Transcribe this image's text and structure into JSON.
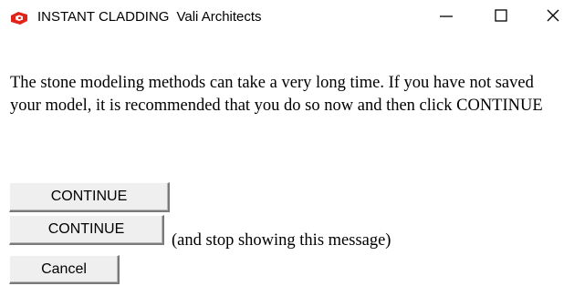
{
  "window": {
    "title": "INSTANT CLADDING",
    "subtitle": "Vali Architects",
    "app_icon": "sketchup-icon",
    "controls": {
      "minimize_icon": "minimize-icon",
      "maximize_icon": "maximize-icon",
      "close_icon": "close-icon"
    }
  },
  "dialog": {
    "message": "The stone modeling methods can take a very long time. If you have not saved your model, it is recommended that you do so now and then click CONTINUE",
    "continue_label": "CONTINUE",
    "continue_stop_label": "CONTINUE",
    "stop_showing_text": "(and stop showing this message)",
    "cancel_label": "Cancel"
  },
  "colors": {
    "icon_red": "#e2231a",
    "button_face": "#efefef",
    "text": "#000000"
  }
}
